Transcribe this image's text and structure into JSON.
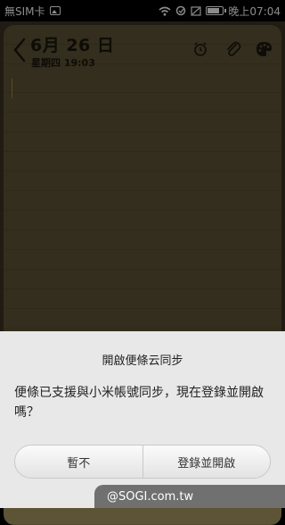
{
  "status_bar": {
    "carrier": "無SIM卡",
    "time": "晚上07:04",
    "icons": [
      "image-icon",
      "wifi-icon",
      "sync-icon",
      "signal-icon",
      "battery-icon"
    ]
  },
  "note": {
    "date": "6月 26 日",
    "weekday_time": "星期四 19:03",
    "icons": [
      "back-icon",
      "alarm-icon",
      "attach-icon",
      "palette-icon"
    ]
  },
  "dialog": {
    "title": "開啟便條云同步",
    "message": "便條已支援與小米帳號同步，現在登錄並開啟嗎？",
    "cancel_label": "暫不",
    "confirm_label": "登錄並開啟"
  },
  "watermark": {
    "text": "@SOGI.com.tw"
  },
  "colors": {
    "paper": "#5d5435",
    "dialog_bg": "#e8e8e8"
  }
}
